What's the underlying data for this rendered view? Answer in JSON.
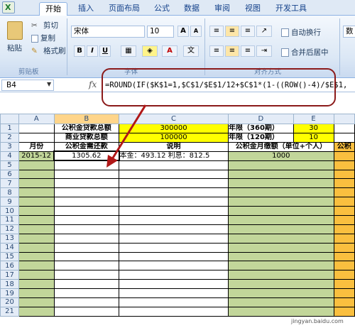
{
  "tabs": [
    "开始",
    "插入",
    "页面布局",
    "公式",
    "数据",
    "审阅",
    "视图",
    "开发工具"
  ],
  "clipboard": {
    "paste": "粘贴",
    "cut": "剪切",
    "copy": "复制",
    "format_painter": "格式刷",
    "group_label": "剪贴板"
  },
  "font": {
    "name": "宋体",
    "size": "10",
    "group_label": "字体"
  },
  "alignment": {
    "wrap": "自动换行",
    "merge": "合并后居中",
    "group_label": "对齐方式"
  },
  "number": {
    "format": "数"
  },
  "formula_bar": {
    "cell": "B4",
    "fx": "fx",
    "formula": "=ROUND(IF($K$1=1,$C$1/$E$1/12+$C$1*(1-((ROW()-4)/$E$1,"
  },
  "columns": [
    "A",
    "B",
    "C",
    "D",
    "E"
  ],
  "rows": {
    "r1": {
      "b": "公积金贷款总额",
      "c": "300000",
      "d": "年限（360期）",
      "e": "30"
    },
    "r2": {
      "b": "商业贷款总额",
      "c": "100000",
      "d": "年限（120期）",
      "e": "10"
    },
    "r3": {
      "a": "月份",
      "b": "公积金需还款",
      "c": "说明",
      "d": "公积金月缴额（单位+个人）",
      "f": "公积"
    },
    "r4": {
      "a": "2015-12",
      "b": "1305.62",
      "c": "本金：493.12  利息：812.5",
      "d": "1000"
    }
  },
  "row_numbers": [
    "1",
    "2",
    "3",
    "4",
    "5",
    "6",
    "7",
    "8",
    "9",
    "10",
    "11",
    "12",
    "13",
    "14",
    "15",
    "16",
    "17",
    "18",
    "19",
    "20",
    "21"
  ],
  "watermark": "jingyan.baidu.com"
}
